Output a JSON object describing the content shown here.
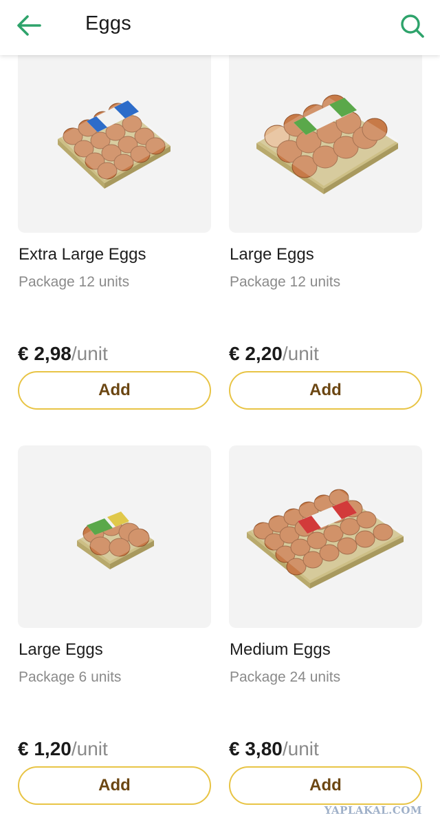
{
  "header": {
    "title": "Eggs",
    "back_icon": "arrow-left-icon",
    "search_icon": "search-icon",
    "accent_color": "#2ea36b"
  },
  "products": [
    {
      "name": "Extra Large Eggs",
      "package": "Package 12 units",
      "price": "€ 2,98",
      "unit": "/unit",
      "add_label": "Add",
      "image": "egg-carton-12-blue-label"
    },
    {
      "name": "Large Eggs",
      "package": "Package 12 units",
      "price": "€ 2,20",
      "unit": "/unit",
      "add_label": "Add",
      "image": "egg-carton-12-green-label"
    },
    {
      "name": "Large Eggs",
      "package": "Package 6 units",
      "price": "€ 1,20",
      "unit": "/unit",
      "add_label": "Add",
      "image": "egg-carton-6-green-label"
    },
    {
      "name": "Medium Eggs",
      "package": "Package 24 units",
      "price": "€ 3,80",
      "unit": "/unit",
      "add_label": "Add",
      "image": "egg-carton-24-red-label"
    }
  ],
  "colors": {
    "button_border": "#e8c445",
    "button_text": "#6b4612",
    "image_background": "#f3f3f3"
  },
  "watermark": "YAPLAKAL.COM"
}
